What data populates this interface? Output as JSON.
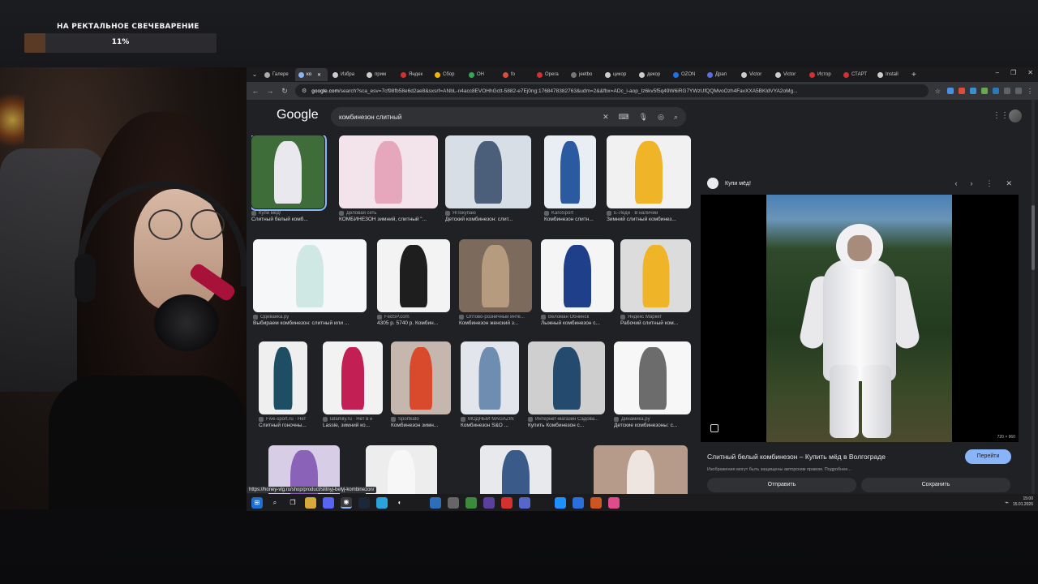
{
  "overlay": {
    "title": "НА РЕКТАЛЬНОЕ СВЕЧЕВАРЕНИЕ",
    "progress_label": "11%",
    "progress": 0.11
  },
  "tabs": [
    "Галере",
    "ко",
    "Избра",
    "прим",
    "Яндек",
    "Сбор",
    "ОН",
    "fo",
    "Opera",
    "jeetbo",
    "цикор",
    "декор",
    "OZON",
    "Драп",
    "Victor",
    "Victor",
    "Истор",
    "СТАРТ",
    "Install"
  ],
  "address": {
    "host": "google.com",
    "path": "/search?sca_esv=7cf98fb58e6d2ae8&sxsrf=ANbL-n4acc8EVOHhGctt-5882-e7Ej0ng:1768478382763&udm=2&&fbx=ADc_i-aop_Iz6kv5f5q49W6iRG7YWzUfQQMvoOzh4FavXXA5BKldVYA2oMg..."
  },
  "search": {
    "logo": "Google",
    "query": "комбинезон слитный"
  },
  "results": [
    {
      "source": "Купи мёд!",
      "caption": "Слитный белый комб..."
    },
    {
      "source": "Деловая сеть",
      "caption": "КОМБИНЕЗОН зимний, слитный \"..."
    },
    {
      "source": "ЯПокупаю",
      "caption": "Детский комбинезон: слит..."
    },
    {
      "source": "KaroSport",
      "caption": "Комбинезон слитн..."
    },
    {
      "source": "Е-Леди · В наличии",
      "caption": "Зимний слитный комбинез..."
    },
    {
      "source": "Одевайка.ру",
      "caption": "Выбираем комбинезон: слитный или ..."
    },
    {
      "source": "FedSP.com",
      "caption": "4305 р. 5740 р. Комбин..."
    },
    {
      "source": "Оптово-розничный инте...",
      "caption": "Комбинезон женский з..."
    },
    {
      "source": "Веломан Обнинск",
      "caption": "Лыжный комбинезон с..."
    },
    {
      "source": "Яндекс Маркет",
      "caption": "Рабочий слитный ком..."
    },
    {
      "source": "Five-sport.ru · Нет",
      "caption": "Слитный гоночны..."
    },
    {
      "source": "lafamily.ru · Нет в н",
      "caption": "Lassie, зимний ко..."
    },
    {
      "source": "Sportkato",
      "caption": "Комбинезон зимн..."
    },
    {
      "source": "МОДНЫЙ MAGAZIN",
      "caption": "Комбинезон S&O ..."
    },
    {
      "source": "Интернет-магазин Садова...",
      "caption": "Купить Комбинезон с..."
    },
    {
      "source": "Динамика.ру",
      "caption": "Детские комбинезоны: с..."
    }
  ],
  "preview": {
    "site": "Купи мёд!",
    "title": "Слитный белый комбинезон – Купить мёд в Волгограде",
    "visit": "Перейти",
    "note": "Изображения могут быть защищены авторским правом. Подробнее...",
    "share": "Отправить",
    "save": "Сохранить",
    "size": "720 × 960"
  },
  "status_url": "https://honey-vlg.ru/shop/product/slitnyj-belyj-kombinezon/",
  "clock": {
    "time": "15:00",
    "date": "15.01.2026"
  }
}
